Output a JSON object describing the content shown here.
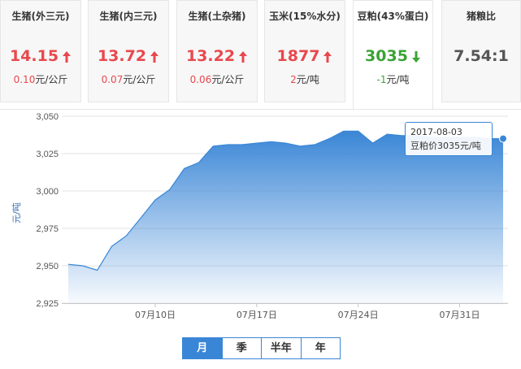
{
  "cards": [
    {
      "title": "生猪(外三元)",
      "price": "14.15",
      "direction": "up",
      "change": "0.10",
      "unit": "元/公斤"
    },
    {
      "title": "生猪(内三元)",
      "price": "13.72",
      "direction": "up",
      "change": "0.07",
      "unit": "元/公斤"
    },
    {
      "title": "生猪(土杂猪)",
      "price": "13.22",
      "direction": "up",
      "change": "0.06",
      "unit": "元/公斤"
    },
    {
      "title": "玉米(15%水分)",
      "price": "1877",
      "direction": "up",
      "change": "2",
      "unit": "元/吨"
    },
    {
      "title": "豆粕(43%蛋白)",
      "price": "3035",
      "direction": "down",
      "change": "-1",
      "unit": "元/吨"
    },
    {
      "title": "猪粮比",
      "price": "7.54:1",
      "direction": "flat",
      "change": "",
      "unit": ""
    }
  ],
  "active_card_index": 4,
  "colors": {
    "up": "#e8484e",
    "down": "#3aa335",
    "accent": "#3a86d6"
  },
  "tooltip": {
    "date": "2017-08-03",
    "text": "豆粕价3035元/吨"
  },
  "period_tabs": [
    "月",
    "季",
    "半年",
    "年"
  ],
  "active_period": "月",
  "chart_data": {
    "type": "area",
    "ylabel": "元/吨",
    "ylim": [
      2925,
      3050
    ],
    "yticks": [
      "3,050",
      "3,025",
      "3,000",
      "2,975",
      "2,950",
      "2,925"
    ],
    "ytick_values": [
      3050,
      3025,
      3000,
      2975,
      2950,
      2925
    ],
    "xtick_labels": [
      "07月10日",
      "07月17日",
      "07月24日",
      "07月31日"
    ],
    "xtick_dates": [
      "2017-07-10",
      "2017-07-17",
      "2017-07-24",
      "2017-07-31"
    ],
    "grid": true,
    "series": [
      {
        "x": [
          "2017-07-04",
          "2017-07-05",
          "2017-07-06",
          "2017-07-07",
          "2017-07-08",
          "2017-07-09",
          "2017-07-10",
          "2017-07-11",
          "2017-07-12",
          "2017-07-13",
          "2017-07-14",
          "2017-07-15",
          "2017-07-16",
          "2017-07-17",
          "2017-07-18",
          "2017-07-19",
          "2017-07-20",
          "2017-07-21",
          "2017-07-22",
          "2017-07-23",
          "2017-07-24",
          "2017-07-25",
          "2017-07-26",
          "2017-07-27",
          "2017-07-28",
          "2017-07-29",
          "2017-07-30",
          "2017-07-31",
          "2017-08-01",
          "2017-08-02",
          "2017-08-03"
        ],
        "values": [
          2951,
          2950,
          2947,
          2963,
          2970,
          2982,
          2994,
          3001,
          3015,
          3019,
          3030,
          3031,
          3031,
          3032,
          3033,
          3032,
          3030,
          3031,
          3035,
          3040,
          3040,
          3032,
          3038,
          3037,
          3037,
          3036,
          3036,
          3036,
          3036,
          3035,
          3035
        ]
      }
    ]
  }
}
